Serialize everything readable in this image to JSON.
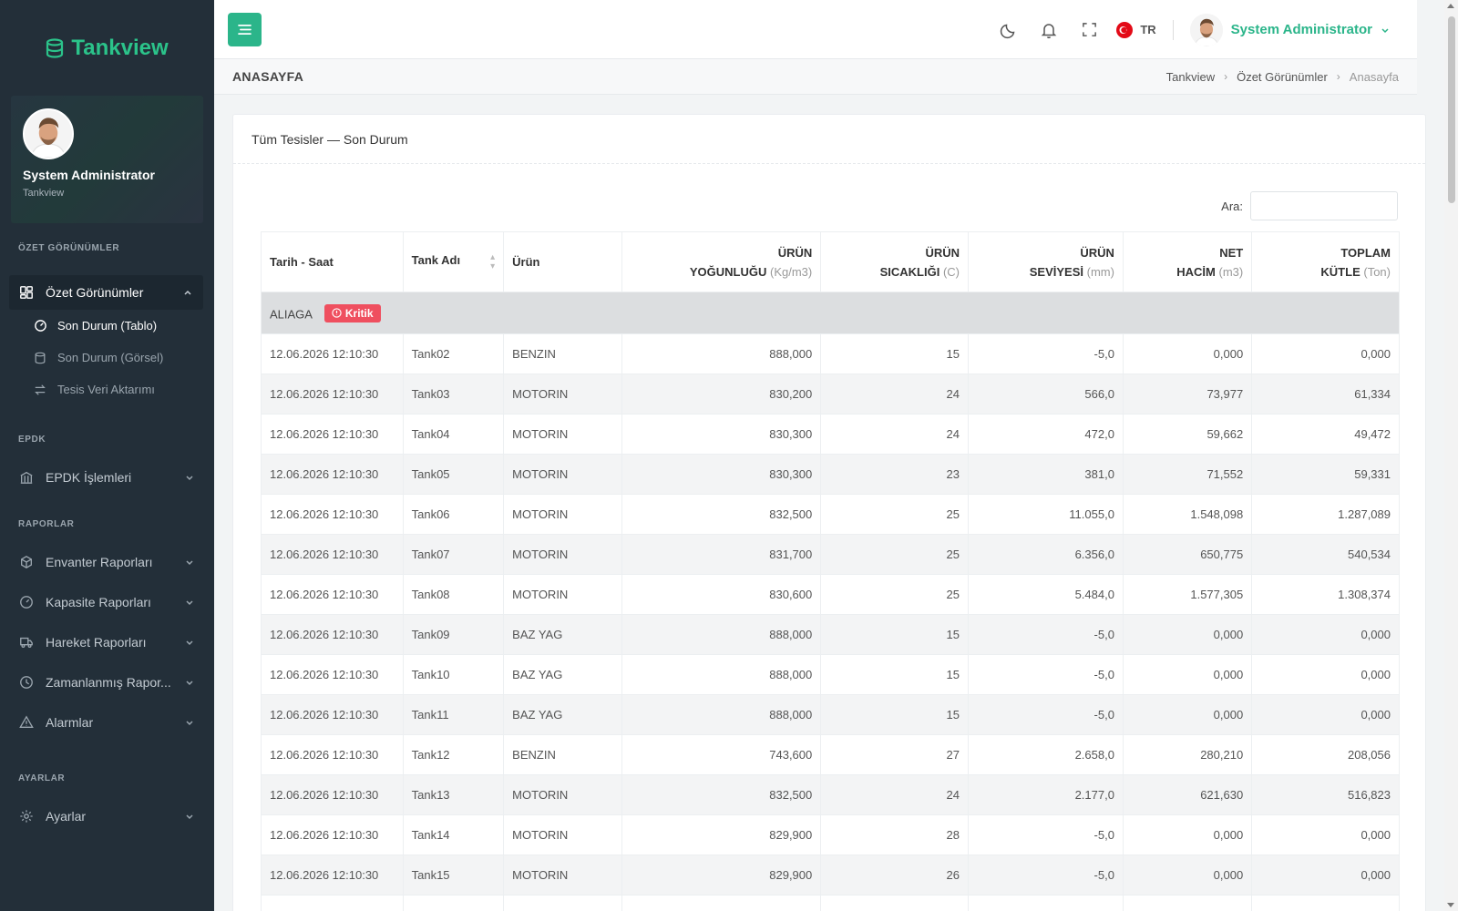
{
  "brand": {
    "name": "Tankview",
    "icon": "database-icon",
    "color": "#2bc38a"
  },
  "profile": {
    "name": "System Administrator",
    "org": "Tankview"
  },
  "sidebar": {
    "sections": {
      "ozet": "ÖZET GÖRÜNÜMLER",
      "epdk": "EPDK",
      "raporlar": "RAPORLAR",
      "ayarlar": "AYARLAR"
    },
    "ozet_menu": {
      "label": "Özet Görünümler",
      "icon": "grid-icon"
    },
    "sub_items": [
      {
        "label": "Son Durum (Tablo)",
        "icon": "gauge-icon"
      },
      {
        "label": "Son Durum (Görsel)",
        "icon": "database-icon"
      },
      {
        "label": "Tesis Veri Aktarımı",
        "icon": "swap-icon"
      }
    ],
    "epdk_menu": {
      "label": "EPDK İşlemleri",
      "icon": "bank-icon"
    },
    "report_menus": [
      {
        "label": "Envanter Raporları",
        "icon": "box-icon"
      },
      {
        "label": "Kapasite Raporları",
        "icon": "gauge-icon"
      },
      {
        "label": "Hareket Raporları",
        "icon": "truck-icon"
      },
      {
        "label": "Zamanlanmış Rapor...",
        "icon": "clock-icon"
      },
      {
        "label": "Alarmlar",
        "icon": "warning-icon"
      }
    ],
    "settings_menu": {
      "label": "Ayarlar",
      "icon": "gear-icon"
    }
  },
  "topbar": {
    "language": "TR",
    "user": "System Administrator",
    "accent": "#2bb58a"
  },
  "page": {
    "title": "ANASAYFA",
    "breadcrumb": [
      "Tankview",
      "Özet Görünümler",
      "Anasayfa"
    ]
  },
  "card": {
    "title": "Tüm Tesisler — Son Durum",
    "search_label": "Ara:",
    "search_value": ""
  },
  "table": {
    "headers": {
      "date": "Tarih - Saat",
      "tank": "Tank Adı",
      "product": "Ürün",
      "density": {
        "l1": "ÜRÜN",
        "l2": "YOĞUNLUĞU",
        "unit": "(Kg/m3)"
      },
      "temp": {
        "l1": "ÜRÜN",
        "l2": "SICAKLIĞI",
        "unit": "(C)"
      },
      "level": {
        "l1": "ÜRÜN",
        "l2": "SEVİYESİ",
        "unit": "(mm)"
      },
      "volume": {
        "l1": "NET",
        "l2": "HACİM",
        "unit": "(m3)"
      },
      "mass": {
        "l1": "TOPLAM",
        "l2": "KÜTLE",
        "unit": "(Ton)"
      }
    },
    "group": {
      "name": "ALIAGA",
      "badge": "Kritik",
      "badge_color": "#ef4f5f"
    },
    "rows": [
      [
        "12.06.2026 12:10:30",
        "Tank02",
        "BENZIN",
        "888,000",
        "15",
        "-5,0",
        "0,000",
        "0,000"
      ],
      [
        "12.06.2026 12:10:30",
        "Tank03",
        "MOTORIN",
        "830,200",
        "24",
        "566,0",
        "73,977",
        "61,334"
      ],
      [
        "12.06.2026 12:10:30",
        "Tank04",
        "MOTORIN",
        "830,300",
        "24",
        "472,0",
        "59,662",
        "49,472"
      ],
      [
        "12.06.2026 12:10:30",
        "Tank05",
        "MOTORIN",
        "830,300",
        "23",
        "381,0",
        "71,552",
        "59,331"
      ],
      [
        "12.06.2026 12:10:30",
        "Tank06",
        "MOTORIN",
        "832,500",
        "25",
        "11.055,0",
        "1.548,098",
        "1.287,089"
      ],
      [
        "12.06.2026 12:10:30",
        "Tank07",
        "MOTORIN",
        "831,700",
        "25",
        "6.356,0",
        "650,775",
        "540,534"
      ],
      [
        "12.06.2026 12:10:30",
        "Tank08",
        "MOTORIN",
        "830,600",
        "25",
        "5.484,0",
        "1.577,305",
        "1.308,374"
      ],
      [
        "12.06.2026 12:10:30",
        "Tank09",
        "BAZ YAG",
        "888,000",
        "15",
        "-5,0",
        "0,000",
        "0,000"
      ],
      [
        "12.06.2026 12:10:30",
        "Tank10",
        "BAZ YAG",
        "888,000",
        "15",
        "-5,0",
        "0,000",
        "0,000"
      ],
      [
        "12.06.2026 12:10:30",
        "Tank11",
        "BAZ YAG",
        "888,000",
        "15",
        "-5,0",
        "0,000",
        "0,000"
      ],
      [
        "12.06.2026 12:10:30",
        "Tank12",
        "BENZIN",
        "743,600",
        "27",
        "2.658,0",
        "280,210",
        "208,056"
      ],
      [
        "12.06.2026 12:10:30",
        "Tank13",
        "MOTORIN",
        "832,500",
        "24",
        "2.177,0",
        "621,630",
        "516,823"
      ],
      [
        "12.06.2026 12:10:30",
        "Tank14",
        "MOTORIN",
        "829,900",
        "28",
        "-5,0",
        "0,000",
        "0,000"
      ],
      [
        "12.06.2026 12:10:30",
        "Tank15",
        "MOTORIN",
        "829,900",
        "26",
        "-5,0",
        "0,000",
        "0,000"
      ],
      [
        "",
        "",
        "",
        "",
        "",
        "",
        "",
        ""
      ]
    ]
  }
}
